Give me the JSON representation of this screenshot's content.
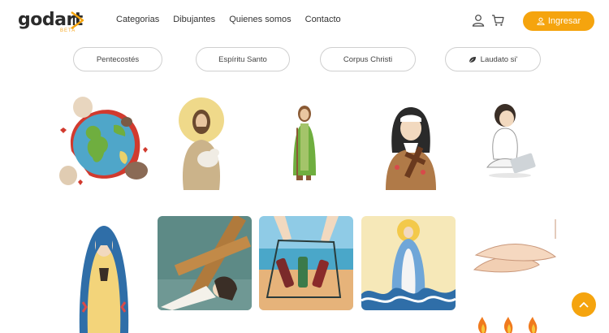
{
  "header": {
    "logo_text": "godart",
    "logo_beta": "BETA",
    "nav": [
      "Categorias",
      "Dibujantes",
      "Quienes somos",
      "Contacto"
    ],
    "login_label": "Ingresar",
    "icons": {
      "user": "user-icon",
      "cart": "cart-icon",
      "login": "user-icon"
    }
  },
  "categories": [
    {
      "label": "Pentecostés"
    },
    {
      "label": "Espíritu Santo"
    },
    {
      "label": "Corpus Christi"
    },
    {
      "label": "Laudato si'",
      "icon": "leaf-icon"
    }
  ],
  "colors": {
    "accent": "#f5a40e",
    "text": "#333333",
    "pill_border": "#cfcfcf"
  },
  "gallery": {
    "row1": [
      {
        "subject": "hands around earth globe"
      },
      {
        "subject": "Jesus good shepherd with lamb"
      },
      {
        "subject": "Saint Joseph with lily staff"
      },
      {
        "subject": "Saint Teresa holding cross with roses"
      },
      {
        "subject": "young man with laptop"
      }
    ],
    "row2": [
      {
        "subject": "Virgin Mary of Guadalupe"
      },
      {
        "subject": "Jesus fallen under the cross"
      },
      {
        "subject": "hands collecting plastic bottles on beach"
      },
      {
        "subject": "Virgin Mary over ocean waves"
      },
      {
        "subject": "open hands receiving"
      }
    ]
  },
  "scroll_top": {
    "icon": "chevron-up-icon"
  }
}
